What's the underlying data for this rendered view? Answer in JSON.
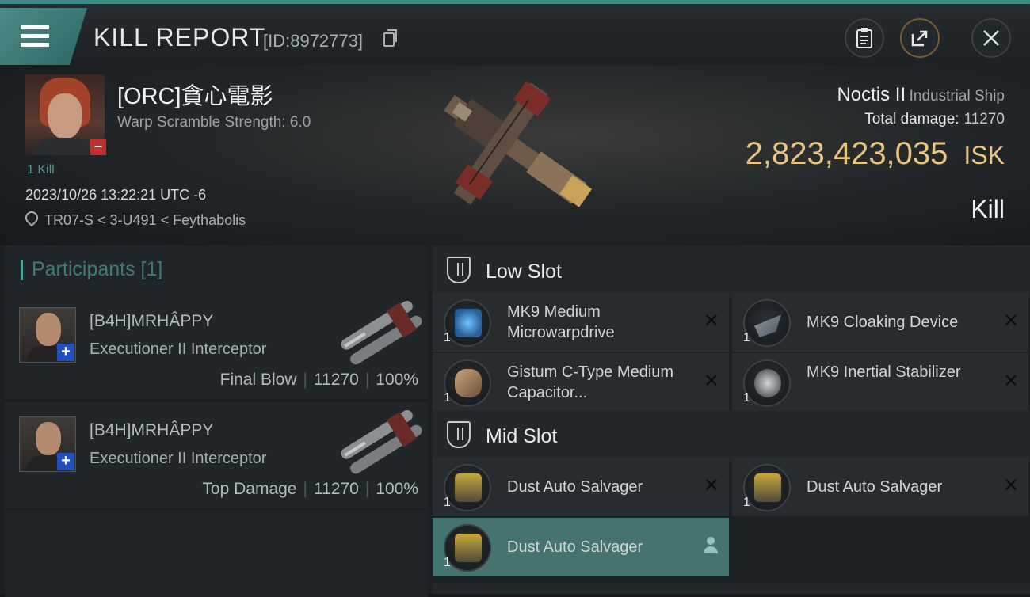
{
  "header": {
    "title": "KILL REPORT",
    "report_id": "[ID:8972773]",
    "menu_icon": "hamburger-icon",
    "buttons": [
      {
        "name": "clipboard-icon",
        "accent": "#3b4246"
      },
      {
        "name": "share-icon",
        "accent": "#7a5b30"
      },
      {
        "name": "close-icon",
        "accent": "#3b4246"
      }
    ]
  },
  "victim": {
    "name": "[ORC]貪心電影",
    "warp_scramble": "Warp Scramble Strength: 6.0",
    "kills": "1 Kill",
    "datetime": "2023/10/26 13:22:21 UTC -6",
    "location": "TR07-S < 3-U491 < Feythabolis",
    "ship_name": "Noctis II",
    "ship_class": "Industrial Ship",
    "total_damage_label": "Total damage:",
    "total_damage_value": "11270",
    "isk_value": "2,823,423,035",
    "isk_unit": "ISK",
    "report_type": "Kill"
  },
  "participants": {
    "title": "Participants [1]",
    "rows": [
      {
        "name": "[B4H]MRHÂPPY",
        "ship": "Executioner II Interceptor",
        "role": "Final Blow",
        "damage": "11270",
        "percent": "100%"
      },
      {
        "name": "[B4H]MRHÂPPY",
        "ship": "Executioner II Interceptor",
        "role": "Top Damage",
        "damage": "11270",
        "percent": "100%"
      }
    ],
    "separator": "|"
  },
  "slots": {
    "low": {
      "title": "Low Slot",
      "modules": [
        {
          "name": "MK9 Medium Microwarpdrive",
          "qty": "1"
        },
        {
          "name": "MK9 Cloaking Device",
          "qty": "1"
        },
        {
          "name": "Gistum C-Type Medium Capacitor...",
          "qty": "1"
        },
        {
          "name": "MK9 Inertial Stabilizer",
          "qty": "1"
        }
      ]
    },
    "mid": {
      "title": "Mid Slot",
      "modules": [
        {
          "name": "Dust Auto Salvager",
          "qty": "1"
        },
        {
          "name": "Dust Auto Salvager",
          "qty": "1"
        },
        {
          "name": "Dust Auto Salvager",
          "qty": "1"
        }
      ]
    },
    "destroyed_mark": "✕"
  },
  "colors": {
    "accent_teal": "#4aa39d",
    "isk_gold": "#e9c57f",
    "selected_module": "#45736f"
  }
}
